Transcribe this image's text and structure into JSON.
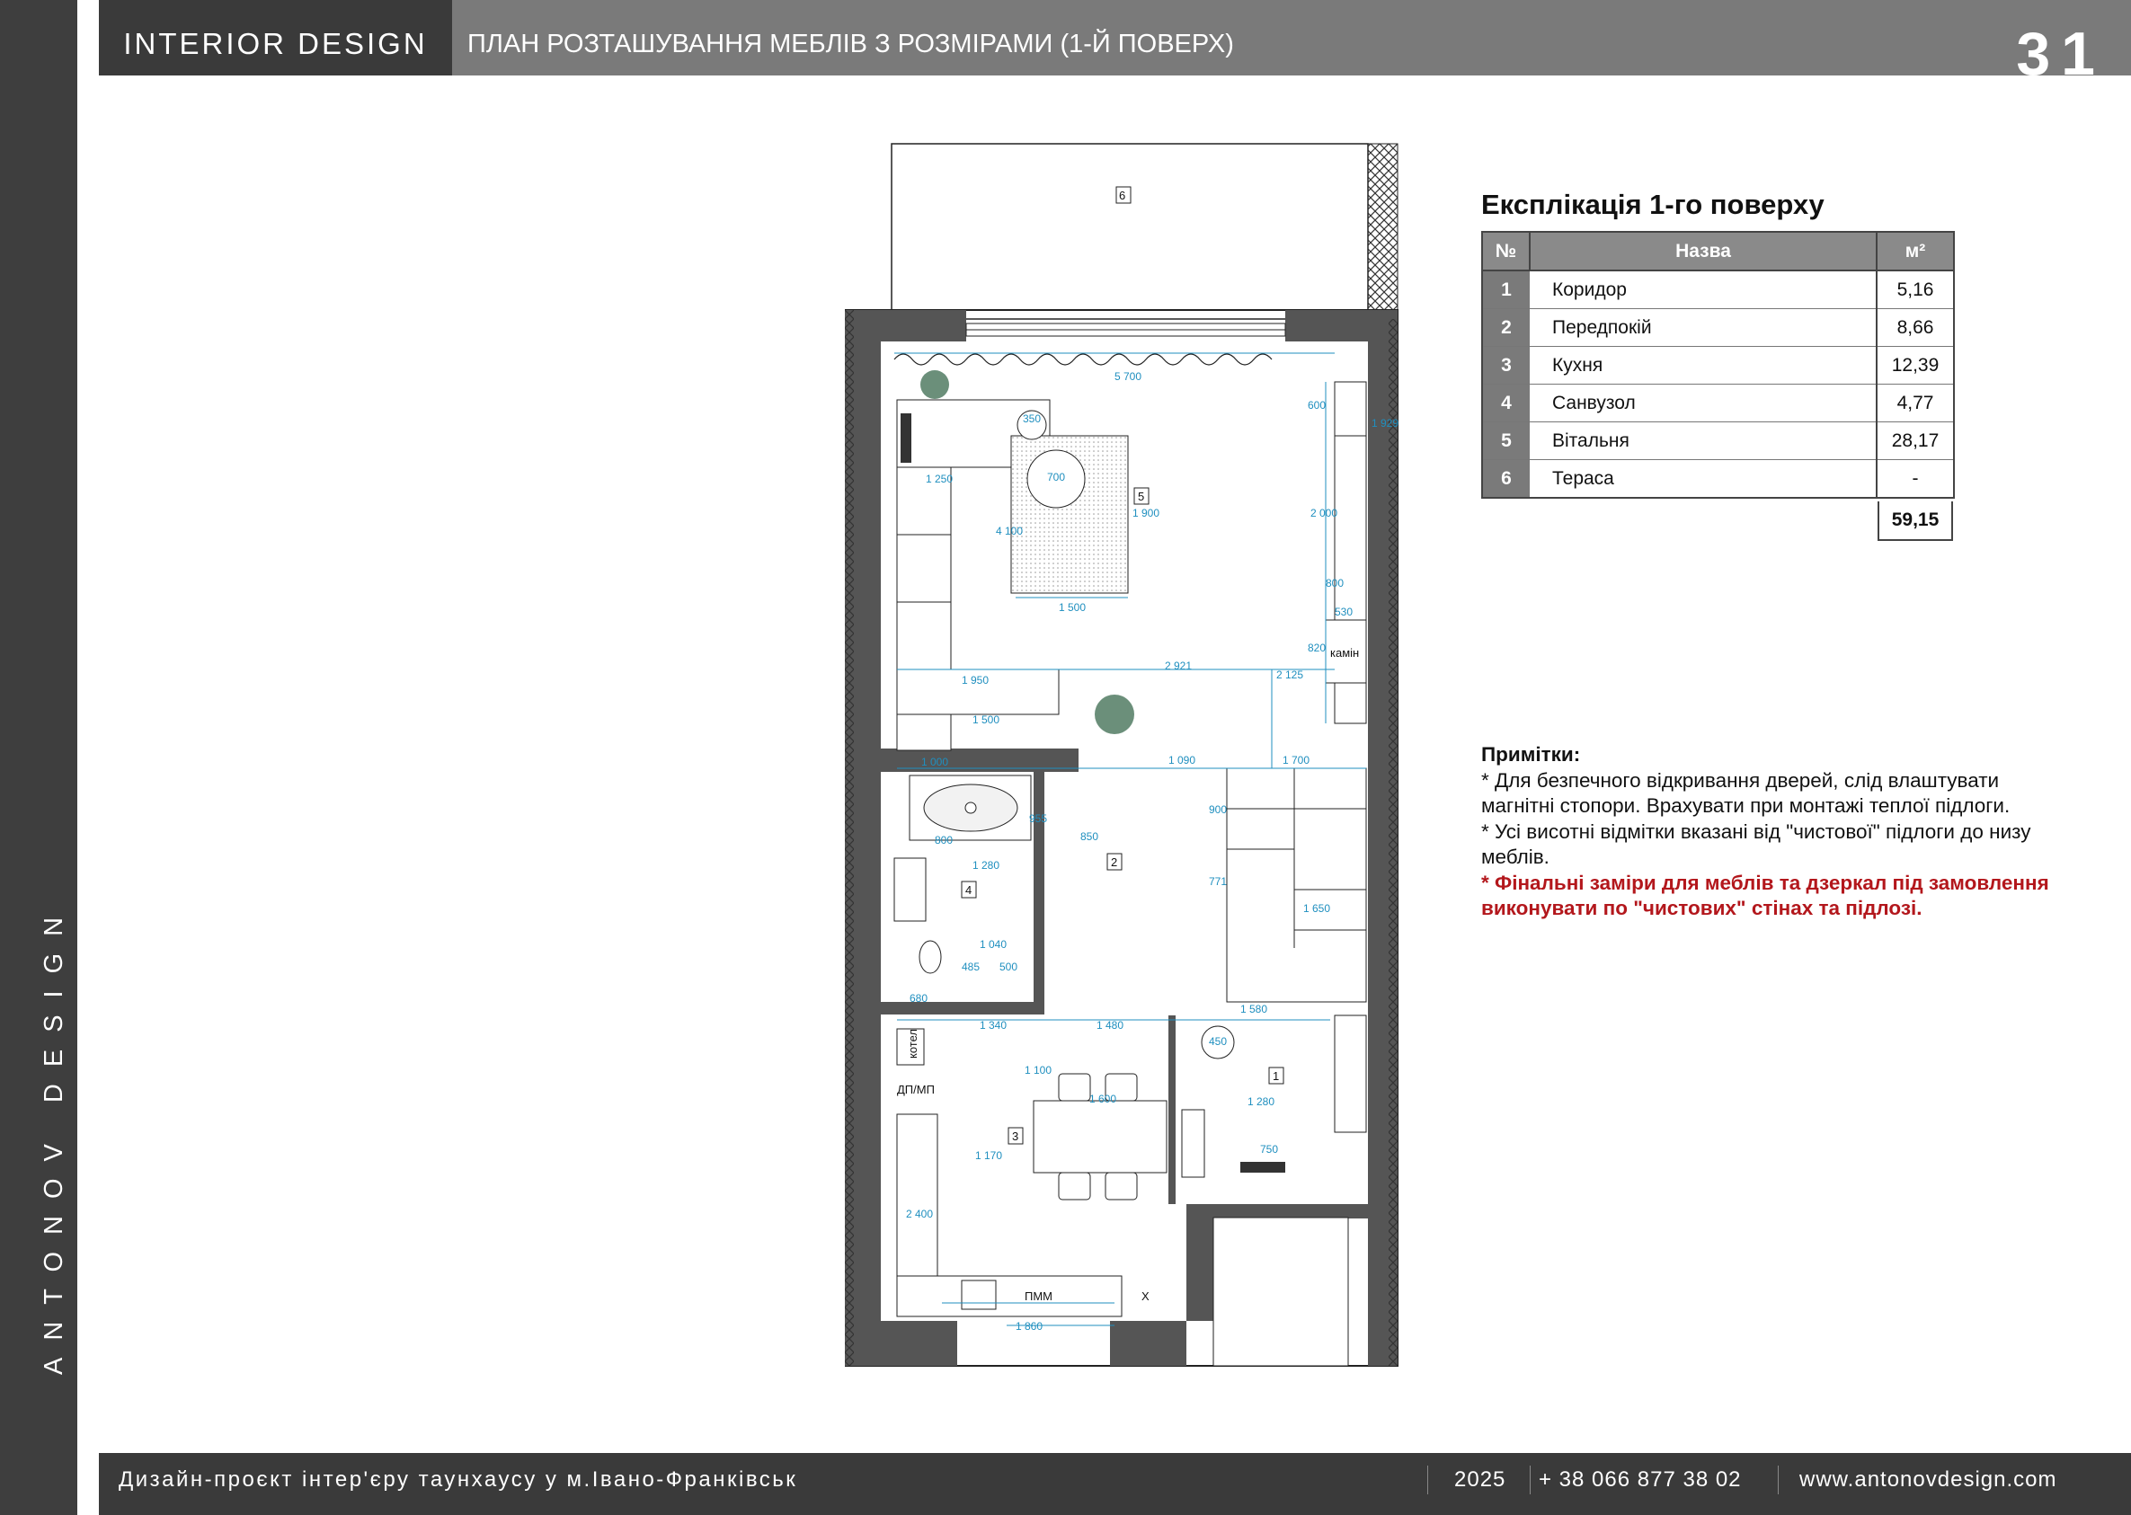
{
  "sidebar": {
    "brand_vertical": "ANTONOV DESIGN"
  },
  "header": {
    "brand": "INTERIOR DESIGN",
    "title": "ПЛАН РОЗТАШУВАННЯ МЕБЛІВ З РОЗМІРАМИ (1-Й ПОВЕРХ)",
    "page_number": "31"
  },
  "explication": {
    "title": "Експлікація 1-го поверху",
    "columns": {
      "no": "№",
      "name": "Назва",
      "area": "м²"
    },
    "rows": [
      {
        "no": "1",
        "name": "Коридор",
        "area": "5,16"
      },
      {
        "no": "2",
        "name": "Передпокій",
        "area": "8,66"
      },
      {
        "no": "3",
        "name": "Кухня",
        "area": "12,39"
      },
      {
        "no": "4",
        "name": "Санвузол",
        "area": "4,77"
      },
      {
        "no": "5",
        "name": "Вітальня",
        "area": "28,17"
      },
      {
        "no": "6",
        "name": "Тераса",
        "area": "-"
      }
    ],
    "total": "59,15"
  },
  "notes": {
    "title": "Примітки:",
    "note1": "* Для безпечного відкривання дверей, слід влаштувати магнітні стопори. Врахувати при монтажі теплої підлоги.",
    "note2": "* Усі висотні відмітки вказані від \"чистової\" підлоги до низу меблів.",
    "note3": "* Фінальні заміри для меблів та дзеркал під замовлення виконувати по \"чистових\" стінах та підлозі."
  },
  "plan": {
    "room_tags": [
      "6",
      "5",
      "2",
      "4",
      "3",
      "1"
    ],
    "labels": {
      "fireplace": "камін",
      "boiler": "котел",
      "dp_mp": "ДП/МП",
      "dishwasher": "ПММ",
      "fridge": "Х"
    },
    "dimensions": {
      "top_width": "5 700",
      "sofa_len": "1 250",
      "rug_w": "1 500",
      "rug_h": "1 900",
      "table_d": "700",
      "pouf_d": "350",
      "sofa_total": "1 950",
      "sofa_seat": "1 500",
      "living_w": "2 921",
      "living_h": "2 125",
      "h_4100": "4 100",
      "cab_600": "600",
      "cab_2000": "2 000",
      "cab_1929": "1 929",
      "fire_530": "530",
      "fire_820": "820",
      "fire_800": "800",
      "d1000": "1 000",
      "d1090": "1 090",
      "d1700": "1 700",
      "d850": "850",
      "d900": "900",
      "d771": "771",
      "d1650": "1 650",
      "bath_800": "800",
      "bath_955": "955",
      "d1280": "1 280",
      "d1040": "1 040",
      "d485": "485",
      "d500": "500",
      "d680": "680",
      "d1340": "1 340",
      "d1480": "1 480",
      "d1580": "1 580",
      "d450": "450",
      "d1600": "1 600",
      "d1170": "1 170",
      "d1100": "1 100",
      "d2400": "2 400",
      "d1860": "1 860",
      "d750": "750",
      "d1280b": "1 280"
    }
  },
  "footer": {
    "project": "Дизайн-проєкт інтер'єру таунхаусу у м.Івано-Франківськ",
    "year": "2025",
    "phone": "+ 38 066 877 38 02",
    "website": "www.antonovdesign.com"
  }
}
